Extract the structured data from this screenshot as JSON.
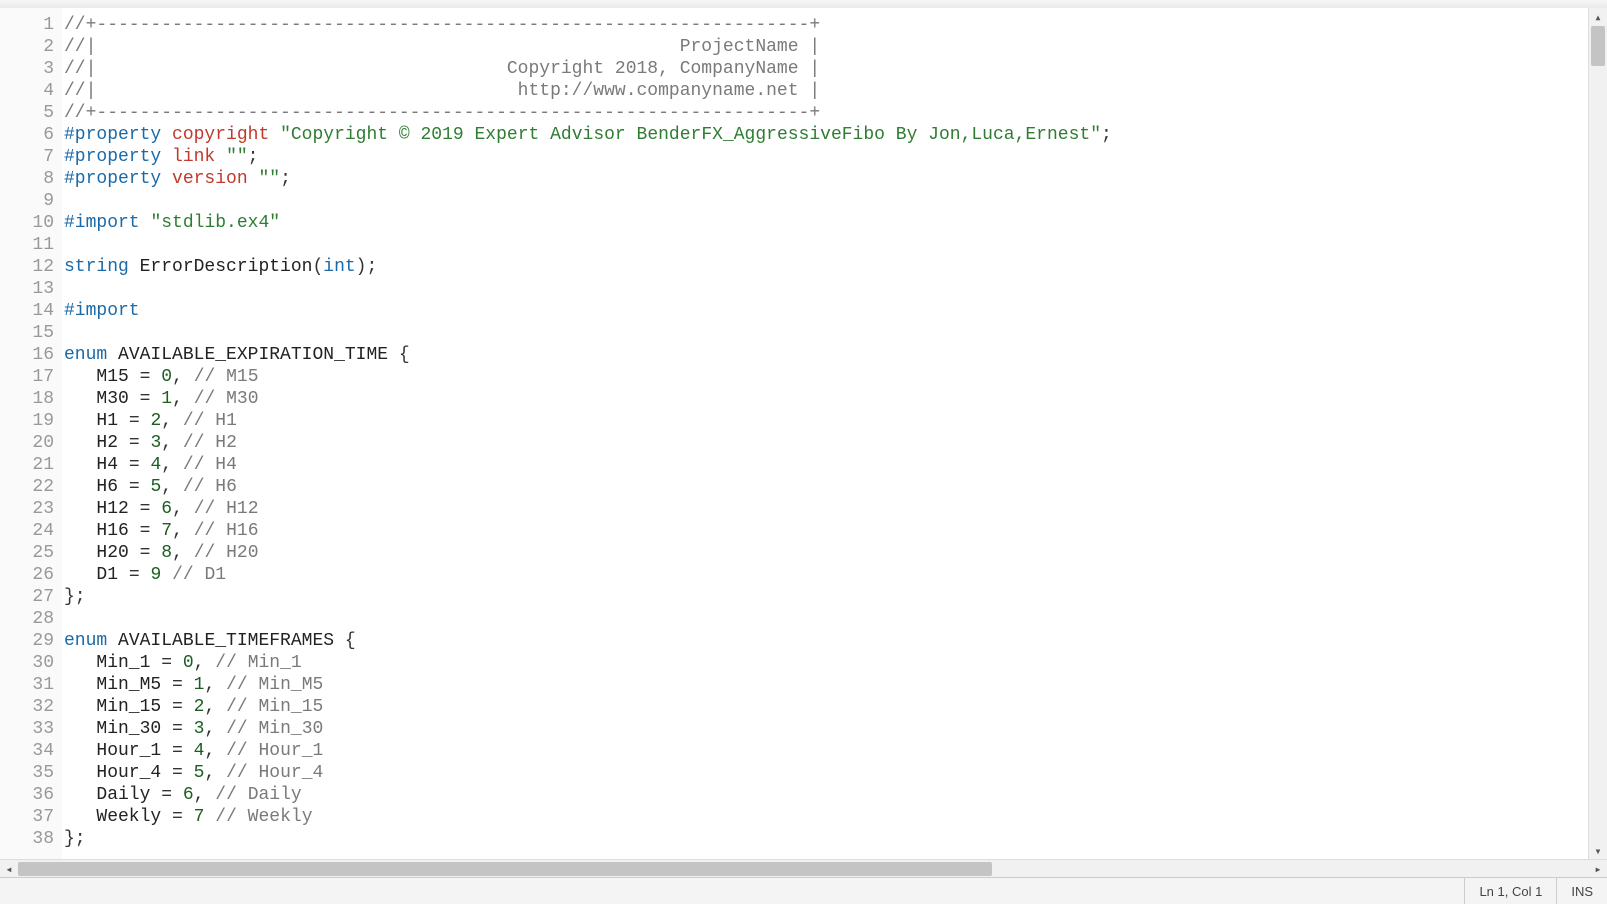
{
  "status": {
    "position": "Ln 1, Col 1",
    "mode": "INS"
  },
  "lines": [
    {
      "n": 1,
      "tokens": [
        {
          "c": "tok-comment",
          "t": "//+------------------------------------------------------------------+"
        }
      ]
    },
    {
      "n": 2,
      "tokens": [
        {
          "c": "tok-comment",
          "t": "//|                                                      ProjectName |"
        }
      ]
    },
    {
      "n": 3,
      "tokens": [
        {
          "c": "tok-comment",
          "t": "//|                                      Copyright 2018, CompanyName |"
        }
      ]
    },
    {
      "n": 4,
      "tokens": [
        {
          "c": "tok-comment",
          "t": "//|                                       http://www.companyname.net |"
        }
      ]
    },
    {
      "n": 5,
      "tokens": [
        {
          "c": "tok-comment",
          "t": "//+------------------------------------------------------------------+"
        }
      ]
    },
    {
      "n": 6,
      "tokens": [
        {
          "c": "tok-directive",
          "t": "#property"
        },
        {
          "c": "",
          "t": " "
        },
        {
          "c": "tok-red",
          "t": "copyright"
        },
        {
          "c": "",
          "t": " "
        },
        {
          "c": "tok-string",
          "t": "\"Copyright © 2019 Expert Advisor BenderFX_AggressiveFibo By Jon,Luca,Ernest\""
        },
        {
          "c": "tok-punc",
          "t": ";"
        }
      ]
    },
    {
      "n": 7,
      "tokens": [
        {
          "c": "tok-directive",
          "t": "#property"
        },
        {
          "c": "",
          "t": " "
        },
        {
          "c": "tok-red",
          "t": "link"
        },
        {
          "c": "",
          "t": " "
        },
        {
          "c": "tok-string",
          "t": "\"\""
        },
        {
          "c": "tok-punc",
          "t": ";"
        }
      ]
    },
    {
      "n": 8,
      "tokens": [
        {
          "c": "tok-directive",
          "t": "#property"
        },
        {
          "c": "",
          "t": " "
        },
        {
          "c": "tok-red",
          "t": "version"
        },
        {
          "c": "",
          "t": " "
        },
        {
          "c": "tok-string",
          "t": "\"\""
        },
        {
          "c": "tok-punc",
          "t": ";"
        }
      ]
    },
    {
      "n": 9,
      "tokens": [
        {
          "c": "",
          "t": ""
        }
      ]
    },
    {
      "n": 10,
      "tokens": [
        {
          "c": "tok-directive",
          "t": "#import"
        },
        {
          "c": "",
          "t": " "
        },
        {
          "c": "tok-string",
          "t": "\"stdlib.ex4\""
        }
      ]
    },
    {
      "n": 11,
      "tokens": [
        {
          "c": "",
          "t": ""
        }
      ]
    },
    {
      "n": 12,
      "tokens": [
        {
          "c": "tok-type",
          "t": "string"
        },
        {
          "c": "",
          "t": " "
        },
        {
          "c": "tok-ident",
          "t": "ErrorDescription"
        },
        {
          "c": "tok-punc",
          "t": "("
        },
        {
          "c": "tok-type",
          "t": "int"
        },
        {
          "c": "tok-punc",
          "t": ");"
        }
      ]
    },
    {
      "n": 13,
      "tokens": [
        {
          "c": "",
          "t": ""
        }
      ]
    },
    {
      "n": 14,
      "tokens": [
        {
          "c": "tok-directive",
          "t": "#import"
        }
      ]
    },
    {
      "n": 15,
      "tokens": [
        {
          "c": "",
          "t": ""
        }
      ]
    },
    {
      "n": 16,
      "tokens": [
        {
          "c": "tok-keyword",
          "t": "enum"
        },
        {
          "c": "",
          "t": " "
        },
        {
          "c": "tok-ident",
          "t": "AVAILABLE_EXPIRATION_TIME"
        },
        {
          "c": "",
          "t": " "
        },
        {
          "c": "tok-punc",
          "t": "{"
        }
      ]
    },
    {
      "n": 17,
      "tokens": [
        {
          "c": "",
          "t": "   "
        },
        {
          "c": "tok-ident",
          "t": "M15"
        },
        {
          "c": "",
          "t": " "
        },
        {
          "c": "tok-punc",
          "t": "="
        },
        {
          "c": "",
          "t": " "
        },
        {
          "c": "tok-number",
          "t": "0"
        },
        {
          "c": "tok-punc",
          "t": ","
        },
        {
          "c": "",
          "t": " "
        },
        {
          "c": "tok-comment",
          "t": "// M15"
        }
      ]
    },
    {
      "n": 18,
      "tokens": [
        {
          "c": "",
          "t": "   "
        },
        {
          "c": "tok-ident",
          "t": "M30"
        },
        {
          "c": "",
          "t": " "
        },
        {
          "c": "tok-punc",
          "t": "="
        },
        {
          "c": "",
          "t": " "
        },
        {
          "c": "tok-number",
          "t": "1"
        },
        {
          "c": "tok-punc",
          "t": ","
        },
        {
          "c": "",
          "t": " "
        },
        {
          "c": "tok-comment",
          "t": "// M30"
        }
      ]
    },
    {
      "n": 19,
      "tokens": [
        {
          "c": "",
          "t": "   "
        },
        {
          "c": "tok-ident",
          "t": "H1"
        },
        {
          "c": "",
          "t": " "
        },
        {
          "c": "tok-punc",
          "t": "="
        },
        {
          "c": "",
          "t": " "
        },
        {
          "c": "tok-number",
          "t": "2"
        },
        {
          "c": "tok-punc",
          "t": ","
        },
        {
          "c": "",
          "t": " "
        },
        {
          "c": "tok-comment",
          "t": "// H1"
        }
      ]
    },
    {
      "n": 20,
      "tokens": [
        {
          "c": "",
          "t": "   "
        },
        {
          "c": "tok-ident",
          "t": "H2"
        },
        {
          "c": "",
          "t": " "
        },
        {
          "c": "tok-punc",
          "t": "="
        },
        {
          "c": "",
          "t": " "
        },
        {
          "c": "tok-number",
          "t": "3"
        },
        {
          "c": "tok-punc",
          "t": ","
        },
        {
          "c": "",
          "t": " "
        },
        {
          "c": "tok-comment",
          "t": "// H2"
        }
      ]
    },
    {
      "n": 21,
      "tokens": [
        {
          "c": "",
          "t": "   "
        },
        {
          "c": "tok-ident",
          "t": "H4"
        },
        {
          "c": "",
          "t": " "
        },
        {
          "c": "tok-punc",
          "t": "="
        },
        {
          "c": "",
          "t": " "
        },
        {
          "c": "tok-number",
          "t": "4"
        },
        {
          "c": "tok-punc",
          "t": ","
        },
        {
          "c": "",
          "t": " "
        },
        {
          "c": "tok-comment",
          "t": "// H4"
        }
      ]
    },
    {
      "n": 22,
      "tokens": [
        {
          "c": "",
          "t": "   "
        },
        {
          "c": "tok-ident",
          "t": "H6"
        },
        {
          "c": "",
          "t": " "
        },
        {
          "c": "tok-punc",
          "t": "="
        },
        {
          "c": "",
          "t": " "
        },
        {
          "c": "tok-number",
          "t": "5"
        },
        {
          "c": "tok-punc",
          "t": ","
        },
        {
          "c": "",
          "t": " "
        },
        {
          "c": "tok-comment",
          "t": "// H6"
        }
      ]
    },
    {
      "n": 23,
      "tokens": [
        {
          "c": "",
          "t": "   "
        },
        {
          "c": "tok-ident",
          "t": "H12"
        },
        {
          "c": "",
          "t": " "
        },
        {
          "c": "tok-punc",
          "t": "="
        },
        {
          "c": "",
          "t": " "
        },
        {
          "c": "tok-number",
          "t": "6"
        },
        {
          "c": "tok-punc",
          "t": ","
        },
        {
          "c": "",
          "t": " "
        },
        {
          "c": "tok-comment",
          "t": "// H12"
        }
      ]
    },
    {
      "n": 24,
      "tokens": [
        {
          "c": "",
          "t": "   "
        },
        {
          "c": "tok-ident",
          "t": "H16"
        },
        {
          "c": "",
          "t": " "
        },
        {
          "c": "tok-punc",
          "t": "="
        },
        {
          "c": "",
          "t": " "
        },
        {
          "c": "tok-number",
          "t": "7"
        },
        {
          "c": "tok-punc",
          "t": ","
        },
        {
          "c": "",
          "t": " "
        },
        {
          "c": "tok-comment",
          "t": "// H16"
        }
      ]
    },
    {
      "n": 25,
      "tokens": [
        {
          "c": "",
          "t": "   "
        },
        {
          "c": "tok-ident",
          "t": "H20"
        },
        {
          "c": "",
          "t": " "
        },
        {
          "c": "tok-punc",
          "t": "="
        },
        {
          "c": "",
          "t": " "
        },
        {
          "c": "tok-number",
          "t": "8"
        },
        {
          "c": "tok-punc",
          "t": ","
        },
        {
          "c": "",
          "t": " "
        },
        {
          "c": "tok-comment",
          "t": "// H20"
        }
      ]
    },
    {
      "n": 26,
      "tokens": [
        {
          "c": "",
          "t": "   "
        },
        {
          "c": "tok-ident",
          "t": "D1"
        },
        {
          "c": "",
          "t": " "
        },
        {
          "c": "tok-punc",
          "t": "="
        },
        {
          "c": "",
          "t": " "
        },
        {
          "c": "tok-number",
          "t": "9"
        },
        {
          "c": "",
          "t": " "
        },
        {
          "c": "tok-comment",
          "t": "// D1"
        }
      ]
    },
    {
      "n": 27,
      "tokens": [
        {
          "c": "tok-punc",
          "t": "};"
        }
      ]
    },
    {
      "n": 28,
      "tokens": [
        {
          "c": "",
          "t": ""
        }
      ]
    },
    {
      "n": 29,
      "tokens": [
        {
          "c": "tok-keyword",
          "t": "enum"
        },
        {
          "c": "",
          "t": " "
        },
        {
          "c": "tok-ident",
          "t": "AVAILABLE_TIMEFRAMES"
        },
        {
          "c": "",
          "t": " "
        },
        {
          "c": "tok-punc",
          "t": "{"
        }
      ]
    },
    {
      "n": 30,
      "tokens": [
        {
          "c": "",
          "t": "   "
        },
        {
          "c": "tok-ident",
          "t": "Min_1"
        },
        {
          "c": "",
          "t": " "
        },
        {
          "c": "tok-punc",
          "t": "="
        },
        {
          "c": "",
          "t": " "
        },
        {
          "c": "tok-number",
          "t": "0"
        },
        {
          "c": "tok-punc",
          "t": ","
        },
        {
          "c": "",
          "t": " "
        },
        {
          "c": "tok-comment",
          "t": "// Min_1"
        }
      ]
    },
    {
      "n": 31,
      "tokens": [
        {
          "c": "",
          "t": "   "
        },
        {
          "c": "tok-ident",
          "t": "Min_M5"
        },
        {
          "c": "",
          "t": " "
        },
        {
          "c": "tok-punc",
          "t": "="
        },
        {
          "c": "",
          "t": " "
        },
        {
          "c": "tok-number",
          "t": "1"
        },
        {
          "c": "tok-punc",
          "t": ","
        },
        {
          "c": "",
          "t": " "
        },
        {
          "c": "tok-comment",
          "t": "// Min_M5"
        }
      ]
    },
    {
      "n": 32,
      "tokens": [
        {
          "c": "",
          "t": "   "
        },
        {
          "c": "tok-ident",
          "t": "Min_15"
        },
        {
          "c": "",
          "t": " "
        },
        {
          "c": "tok-punc",
          "t": "="
        },
        {
          "c": "",
          "t": " "
        },
        {
          "c": "tok-number",
          "t": "2"
        },
        {
          "c": "tok-punc",
          "t": ","
        },
        {
          "c": "",
          "t": " "
        },
        {
          "c": "tok-comment",
          "t": "// Min_15"
        }
      ]
    },
    {
      "n": 33,
      "tokens": [
        {
          "c": "",
          "t": "   "
        },
        {
          "c": "tok-ident",
          "t": "Min_30"
        },
        {
          "c": "",
          "t": " "
        },
        {
          "c": "tok-punc",
          "t": "="
        },
        {
          "c": "",
          "t": " "
        },
        {
          "c": "tok-number",
          "t": "3"
        },
        {
          "c": "tok-punc",
          "t": ","
        },
        {
          "c": "",
          "t": " "
        },
        {
          "c": "tok-comment",
          "t": "// Min_30"
        }
      ]
    },
    {
      "n": 34,
      "tokens": [
        {
          "c": "",
          "t": "   "
        },
        {
          "c": "tok-ident",
          "t": "Hour_1"
        },
        {
          "c": "",
          "t": " "
        },
        {
          "c": "tok-punc",
          "t": "="
        },
        {
          "c": "",
          "t": " "
        },
        {
          "c": "tok-number",
          "t": "4"
        },
        {
          "c": "tok-punc",
          "t": ","
        },
        {
          "c": "",
          "t": " "
        },
        {
          "c": "tok-comment",
          "t": "// Hour_1"
        }
      ]
    },
    {
      "n": 35,
      "tokens": [
        {
          "c": "",
          "t": "   "
        },
        {
          "c": "tok-ident",
          "t": "Hour_4"
        },
        {
          "c": "",
          "t": " "
        },
        {
          "c": "tok-punc",
          "t": "="
        },
        {
          "c": "",
          "t": " "
        },
        {
          "c": "tok-number",
          "t": "5"
        },
        {
          "c": "tok-punc",
          "t": ","
        },
        {
          "c": "",
          "t": " "
        },
        {
          "c": "tok-comment",
          "t": "// Hour_4"
        }
      ]
    },
    {
      "n": 36,
      "tokens": [
        {
          "c": "",
          "t": "   "
        },
        {
          "c": "tok-ident",
          "t": "Daily"
        },
        {
          "c": "",
          "t": " "
        },
        {
          "c": "tok-punc",
          "t": "="
        },
        {
          "c": "",
          "t": " "
        },
        {
          "c": "tok-number",
          "t": "6"
        },
        {
          "c": "tok-punc",
          "t": ","
        },
        {
          "c": "",
          "t": " "
        },
        {
          "c": "tok-comment",
          "t": "// Daily"
        }
      ]
    },
    {
      "n": 37,
      "tokens": [
        {
          "c": "",
          "t": "   "
        },
        {
          "c": "tok-ident",
          "t": "Weekly"
        },
        {
          "c": "",
          "t": " "
        },
        {
          "c": "tok-punc",
          "t": "="
        },
        {
          "c": "",
          "t": " "
        },
        {
          "c": "tok-number",
          "t": "7"
        },
        {
          "c": "",
          "t": " "
        },
        {
          "c": "tok-comment",
          "t": "// Weekly"
        }
      ]
    },
    {
      "n": 38,
      "tokens": [
        {
          "c": "tok-punc",
          "t": "};"
        }
      ]
    }
  ]
}
